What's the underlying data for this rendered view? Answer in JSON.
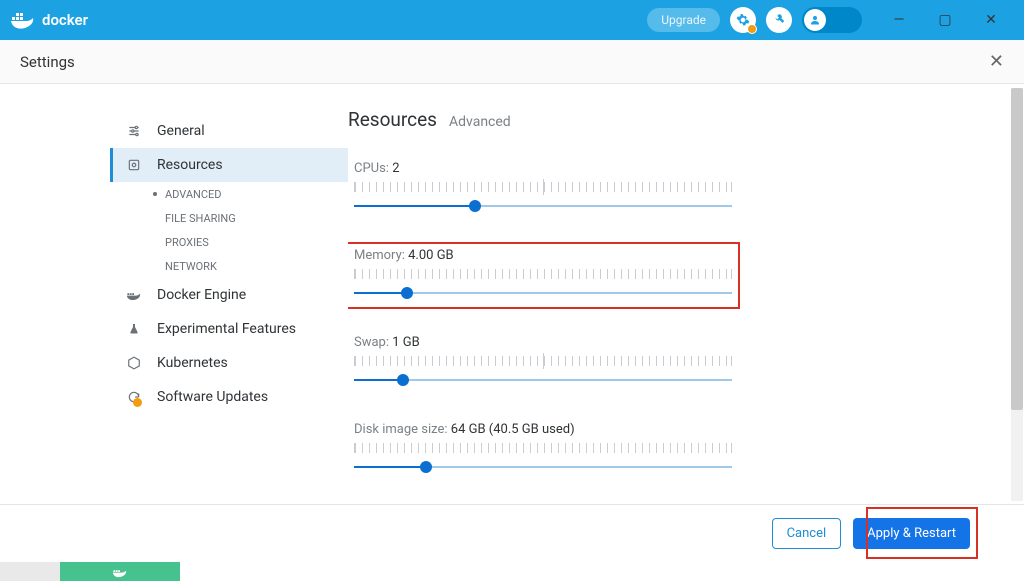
{
  "header": {
    "logo_text": "docker",
    "upgrade_label": "Upgrade"
  },
  "window_controls": {
    "min": "—",
    "max": "▢",
    "close": "✕"
  },
  "settings": {
    "title": "Settings",
    "close": "✕"
  },
  "sidebar": {
    "items": [
      {
        "label": "General"
      },
      {
        "label": "Resources"
      },
      {
        "label": "Docker Engine"
      },
      {
        "label": "Experimental Features"
      },
      {
        "label": "Kubernetes"
      },
      {
        "label": "Software Updates"
      }
    ],
    "sub": [
      {
        "label": "ADVANCED"
      },
      {
        "label": "FILE SHARING"
      },
      {
        "label": "PROXIES"
      },
      {
        "label": "NETWORK"
      }
    ]
  },
  "main": {
    "title": "Resources",
    "subtitle": "Advanced",
    "fields": {
      "cpus": {
        "label": "CPUs:",
        "value": "2",
        "pct": 32
      },
      "memory": {
        "label": "Memory:",
        "value": "4.00 GB",
        "pct": 14
      },
      "swap": {
        "label": "Swap:",
        "value": "1 GB",
        "pct": 13
      },
      "disk": {
        "label": "Disk image size:",
        "value": "64 GB (40.5 GB used)",
        "pct": 19
      }
    }
  },
  "footer": {
    "cancel": "Cancel",
    "apply": "Apply & Restart"
  }
}
